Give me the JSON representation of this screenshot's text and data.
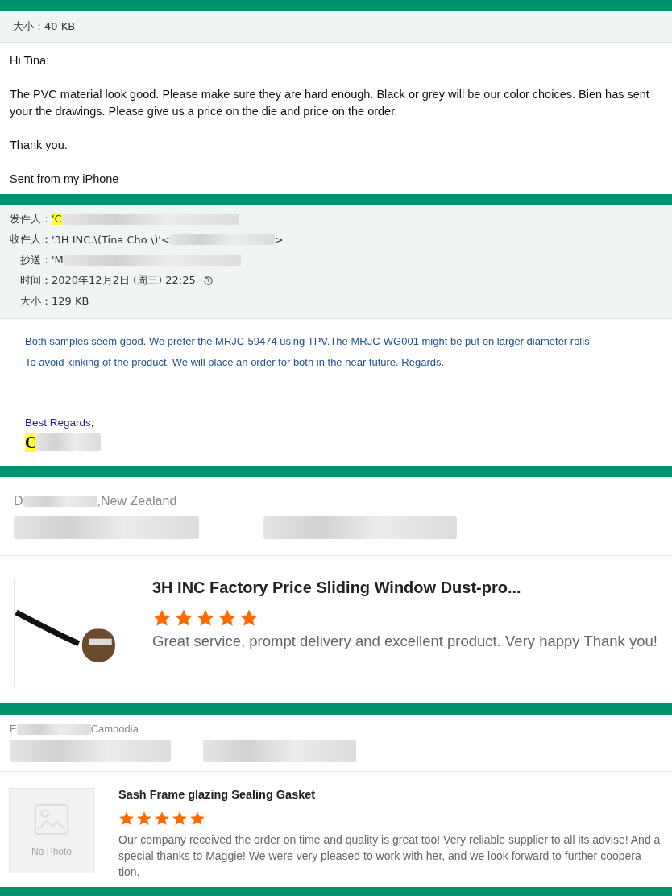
{
  "sections": [
    {
      "kind": "email",
      "header": [
        {
          "label": "大小：",
          "value": "40 KB"
        }
      ],
      "body": [
        {
          "kind": "text",
          "lines": [
            "Hi Tina:"
          ]
        },
        {
          "kind": "text",
          "lines": [
            "The PVC material look good. Please make sure they are hard enough. Black or grey will be our color  choices. Bien has sent your the drawings. Please give us a price on the die and price on the order."
          ]
        },
        {
          "kind": "text",
          "lines": [
            "Thank you."
          ]
        },
        {
          "kind": "text",
          "lines": [
            "Sent from my iPhone"
          ]
        }
      ]
    },
    {
      "kind": "email",
      "header": [
        {
          "label": "发件人：",
          "value": "'C",
          "highlighted": true,
          "redacted": true
        },
        {
          "label": "收件人：",
          "value": "'3H INC.\\(Tina Cho \\)'<",
          "redacted": true,
          "suffix": ">"
        },
        {
          "label": "抄送：",
          "value": "'M",
          "redacted": true
        },
        {
          "label": "时间：",
          "value": "2020年12月2日 (周三) 22:25",
          "kind": "time"
        },
        {
          "label": "大小：",
          "value": "129 KB"
        }
      ],
      "body": [
        {
          "kind": "note",
          "lines": [
            "Both samples seem good. We prefer the MRJC-59474 using TPV.The MRJC-WG001 might be put on larger diameter rolls",
            "To avoid kinking of the product. We will place an order for both in the near future. Regards."
          ]
        },
        {
          "kind": "closing",
          "lines": [
            "Best Regards,"
          ]
        },
        {
          "kind": "signature",
          "lines": [
            "C"
          ],
          "highlighted": true,
          "redacted": true
        }
      ]
    },
    {
      "kind": "review",
      "reviewer": {
        "initial": "D",
        "location": ",New Zealand"
      },
      "product": {
        "title": "3H INC Factory Price Sliding Window Dust-pro...",
        "stars": 5,
        "comment": "Great service, prompt delivery and excellent product. Very happy Thank you!",
        "photo": {
          "kind": "image"
        }
      }
    },
    {
      "kind": "review",
      "reviewer": {
        "initial": "E",
        "location": "Cambodia"
      },
      "product": {
        "title": "Sash Frame glazing Sealing Gasket",
        "stars": 5,
        "comment": "Our company received the order on time and quality is great too! Very reliable supplier to all its advise! And a special thanks to Maggie! We were very pleased to work with her, and we look forward to further coopera tion.",
        "photo": {
          "kind": "none",
          "label": "No Photo"
        }
      }
    }
  ]
}
